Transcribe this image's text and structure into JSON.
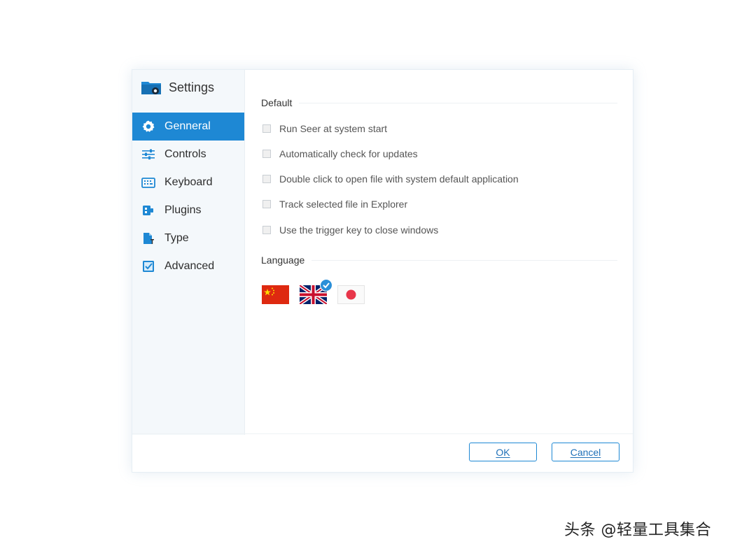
{
  "window": {
    "title": "Settings"
  },
  "sidebar": {
    "items": [
      {
        "label": "Genneral",
        "icon": "gear-icon",
        "active": true
      },
      {
        "label": "Controls",
        "icon": "sliders-icon",
        "active": false
      },
      {
        "label": "Keyboard",
        "icon": "keyboard-icon",
        "active": false
      },
      {
        "label": "Plugins",
        "icon": "plugin-icon",
        "active": false
      },
      {
        "label": "Type",
        "icon": "file-type-icon",
        "active": false
      },
      {
        "label": "Advanced",
        "icon": "checkbox-icon",
        "active": false
      }
    ]
  },
  "main": {
    "default_section": "Default",
    "options": [
      {
        "label": "Run Seer at system start",
        "checked": false
      },
      {
        "label": "Automatically check for updates",
        "checked": false
      },
      {
        "label": "Double click to open file with system default application",
        "checked": false
      },
      {
        "label": "Track selected file in Explorer",
        "checked": false
      },
      {
        "label": "Use the trigger key to close windows",
        "checked": false
      }
    ],
    "language_section": "Language",
    "languages": [
      {
        "name": "china-flag-icon",
        "selected": false
      },
      {
        "name": "uk-flag-icon",
        "selected": true
      },
      {
        "name": "japan-flag-icon",
        "selected": false
      }
    ]
  },
  "footer": {
    "ok_label": "OK",
    "cancel_label": "Cancel"
  },
  "watermark": "头条 @轻量工具集合",
  "colors": {
    "accent": "#1e88d4",
    "sidebar_bg": "#f4f8fb"
  }
}
